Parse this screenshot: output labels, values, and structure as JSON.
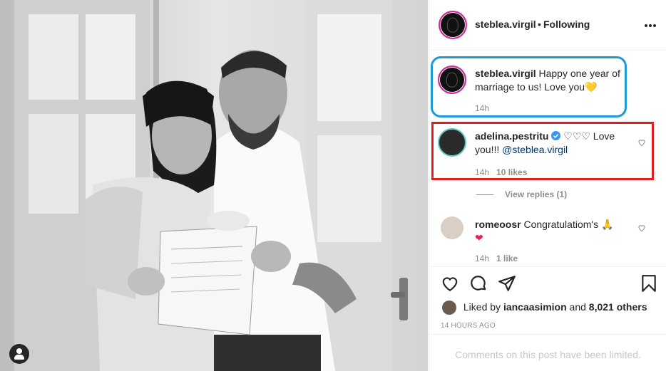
{
  "header": {
    "username": "steblea.virgil",
    "separator": "•",
    "follow_state": "Following",
    "more_icon": "more-horizontal-icon"
  },
  "caption": {
    "username": "steblea.virgil",
    "text": "Happy one year of marriage to us! Love you",
    "emoji": "💛",
    "time": "14h"
  },
  "comments": [
    {
      "username": "adelina.pestritu",
      "verified": true,
      "hearts": "♡♡♡",
      "text": "Love you!!!",
      "mention": "@steblea.virgil",
      "time": "14h",
      "likes": "10 likes"
    },
    {
      "username": "romeoosr",
      "text": "Congratulatiom's",
      "emoji_pray": "🙏",
      "emoji_heart": "❤",
      "time": "14h",
      "likes": "1 like"
    }
  ],
  "view_replies": "View replies (1)",
  "likes_line": {
    "prefix": "Liked by",
    "user": "iancaasimion",
    "middle": "and",
    "count": "8,021 others"
  },
  "timestamp": "14 HOURS AGO",
  "comments_limited": "Comments on this post have been limited.",
  "colors": {
    "highlight_blue": "#1c9ad6",
    "highlight_red": "#e02020",
    "verified": "#3897f0",
    "story_ring": "#d6249f",
    "muted_text": "#8e8e8e"
  }
}
